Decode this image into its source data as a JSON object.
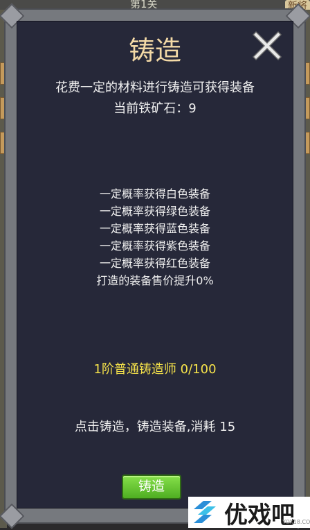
{
  "background": {
    "top_label": "第1关",
    "right_label": "新将"
  },
  "dialog": {
    "title": "铸造",
    "description": "花费一定的材料进行铸造可获得装备",
    "iron_ore": "当前铁矿石：9",
    "probabilities": [
      "一定概率获得白色装备",
      "一定概率获得绿色装备",
      "一定概率获得蓝色装备",
      "一定概率获得紫色装备",
      "一定概率获得红色装备",
      "打造的装备售价提升0%"
    ],
    "forger_rank": "1阶普通铸造师 0/100",
    "instruction": "点击铸造，铸造装备,消耗 15",
    "forge_button": "铸造",
    "close_icon": "close-icon"
  },
  "watermark": {
    "text": "优戏吧",
    "url": "YOX18.COM"
  },
  "colors": {
    "panel_bg": "#262839",
    "frame": "#76797e",
    "title": "#f3d9a6",
    "highlight": "#f5e24a",
    "button": "#62c230"
  }
}
